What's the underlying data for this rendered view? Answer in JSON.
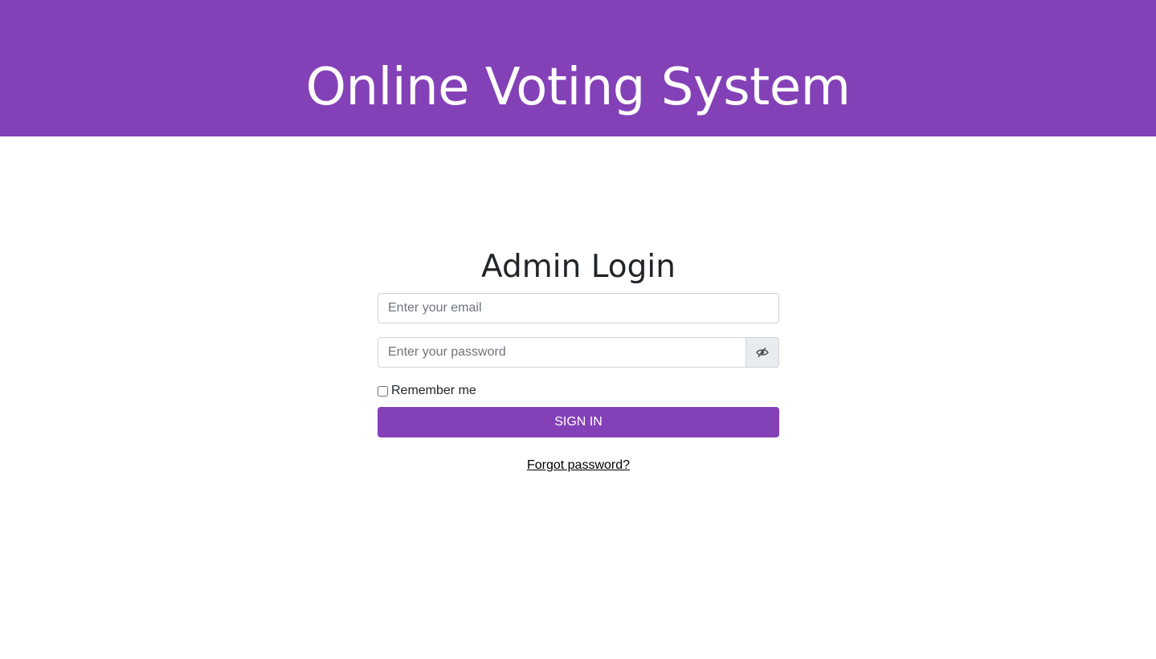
{
  "header": {
    "title": "Online Voting System"
  },
  "login": {
    "title": "Admin Login",
    "email_placeholder": "Enter your email",
    "password_placeholder": "Enter your password",
    "toggle_icon": "eye-slash-icon",
    "remember_label": "Remember me",
    "remember_checked": false,
    "signin_label": "SIGN IN",
    "forgot_label": "Forgot password?"
  },
  "colors": {
    "brand": "#8441b7",
    "background": "#ffffff",
    "input_border": "#ced4da",
    "addon_background": "#e9ecef"
  }
}
